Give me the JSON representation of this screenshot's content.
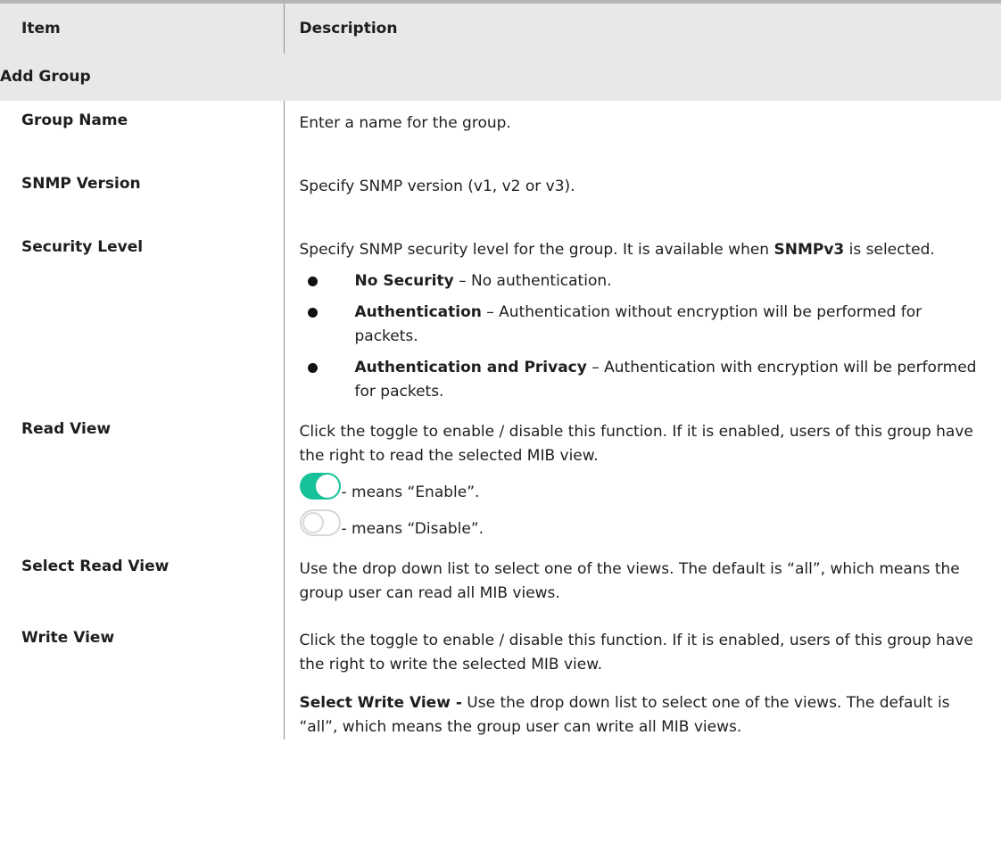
{
  "table": {
    "header": {
      "item": "Item",
      "description": "Description"
    },
    "section_title": "Add Group",
    "rows": {
      "group_name": {
        "label": "Group Name",
        "desc": "Enter a name for the group."
      },
      "snmp_version": {
        "label": "SNMP Version",
        "desc": "Specify SNMP version (v1, v2 or v3)."
      },
      "security_level": {
        "label": "Security Level",
        "desc_a": "Specify SNMP security level for the group. It is available when ",
        "desc_bold": "SNMPv3",
        "desc_b": " is selected.",
        "bullets": [
          {
            "term": "No Security",
            "text": " – No authentication."
          },
          {
            "term": "Authentication",
            "text": " – Authentication without encryption will be performed for packets."
          },
          {
            "term": "Authentication and Privacy",
            "text": " – Authentication with encryption will be performed for packets."
          }
        ]
      },
      "read_view": {
        "label": "Read View",
        "desc": "Click the toggle to enable / disable this function. If it is enabled, users of this group have the right to read the selected MIB view.",
        "toggle_on_text": " - means “Enable”.",
        "toggle_off_text": " - means “Disable”."
      },
      "select_read_view": {
        "label": "Select Read View",
        "desc": "Use the drop down list to select one of the views. The default is “all”, which means the group user can read all MIB views."
      },
      "write_view": {
        "label": "Write View",
        "desc": "Click the toggle to enable / disable this function. If it is enabled, users of this group have the right to write the selected MIB view.",
        "sub_bold": "Select Write View -",
        "sub_text": " Use the drop down list to select one of the views. The default is “all”, which means the group user can write all MIB views."
      }
    }
  },
  "colors": {
    "toggle_on": "#17c29a",
    "toggle_off_border": "#d7d7d7",
    "header_bg": "#e8e8e8"
  }
}
